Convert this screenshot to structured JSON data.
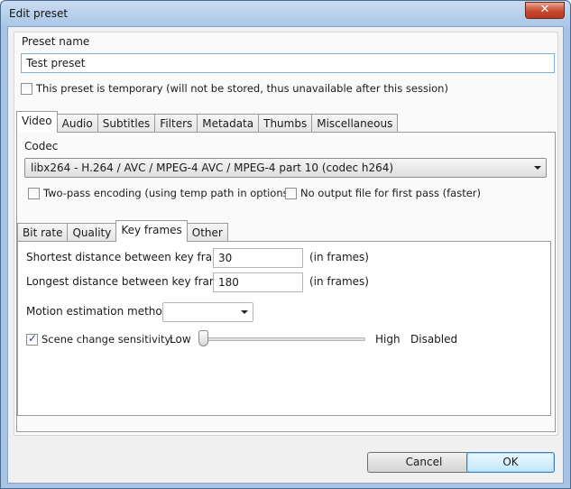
{
  "window": {
    "title": "Edit preset",
    "close_glyph": "✕"
  },
  "preset": {
    "name_label": "Preset name",
    "name_value": "Test preset",
    "temporary_label": "This preset is temporary (will not be stored, thus unavailable after this session)",
    "temporary_checked": false
  },
  "main_tabs": [
    "Video",
    "Audio",
    "Subtitles",
    "Filters",
    "Metadata",
    "Thumbs",
    "Miscellaneous"
  ],
  "main_tab_active": "Video",
  "codec": {
    "label": "Codec",
    "selected": "libx264 - H.264 / AVC / MPEG-4 AVC / MPEG-4 part 10 (codec h264)",
    "two_pass_label": "Two-pass encoding (using temp path in options)",
    "two_pass_checked": false,
    "no_output_label": "No output file for first pass (faster)",
    "no_output_checked": false
  },
  "sub_tabs": [
    "Bit rate",
    "Quality",
    "Key frames",
    "Other"
  ],
  "sub_tab_active": "Key frames",
  "key_frames": {
    "shortest_label": "Shortest distance between key frames:",
    "shortest_value": "30",
    "shortest_unit": "(in frames)",
    "longest_label": "Longest distance between key frames:",
    "longest_value": "180",
    "longest_unit": "(in frames)",
    "motion_label": "Motion estimation method:",
    "motion_value": "",
    "scene_label": "Scene change sensitivity:",
    "scene_checked": true,
    "slider_low": "Low",
    "slider_high": "High",
    "slider_status": "Disabled",
    "slider_level": 0
  },
  "buttons": {
    "cancel": "Cancel",
    "ok": "OK"
  }
}
